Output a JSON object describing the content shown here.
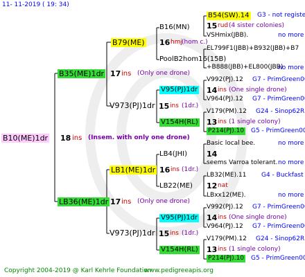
{
  "header": {
    "date": "11-  11-2019 (  19:  34)"
  },
  "footer": {
    "copyright": "Copyright 2004-2019 @ Karl Kehrle Foundation",
    "website": "www.pedigreeapis.org"
  },
  "root": {
    "name": "B10(ME)1dr"
  },
  "root_info": {
    "count": "18",
    "unit": "ins",
    "note": "(Insem. with only one drone)"
  },
  "upper": {
    "name": "B35(ME)1dr",
    "count": "17",
    "unit": "ins",
    "note": "(Only one drone)",
    "dam": {
      "name": "B79(ME)",
      "count": "16",
      "unit": "hmj",
      "note": "(hom c.)",
      "dam": {
        "name": "B16(MN)",
        "count": "15",
        "unit": "rud",
        "note": "(4 sister colonies)",
        "dam": "B54(SW).14",
        "dam_meta": "G3 - not registe",
        "sire": "VSHmix(JBB).",
        "sire_meta": "no more"
      },
      "sire": {
        "name": "PoolB2hom16(15B)",
        "dam": "EL799F1(JBB)+B932(JBB)+B7",
        "sire": "+B888(JBB)+EL800(JBB)",
        "sire_meta": "no more"
      }
    },
    "sire": {
      "name": "V973(PJ)1dr",
      "count": "15",
      "unit": "ins",
      "note": "(1dr.)",
      "dam": {
        "name": "V95(PJ)1dr",
        "count": "14",
        "unit": "ins",
        "note": "(One single drone)",
        "dam": "V992(PJ).12",
        "dam_meta": "G7 - PrimGreen00",
        "sire": "V964(PJ).12",
        "sire_meta": "G7 - PrimGreen00"
      },
      "sire": {
        "name": "V154H(RL)",
        "count": "13",
        "unit": "ins",
        "note": "(1 single colony)",
        "dam": "V179(PM).12",
        "dam_meta": "G24 - Sinop62R",
        "sire": "P214(PJ).10",
        "sire_meta": "G5 - PrimGreen00"
      }
    }
  },
  "lower": {
    "name": "LB36(ME)1dr",
    "count": "17",
    "unit": "ins",
    "note": "(Only one drone)",
    "dam": {
      "name": "LB1(ME)1dr",
      "count": "16",
      "unit": "ins",
      "note": "(1dr.)",
      "dam": {
        "name": "LB4(JHI)",
        "count": "14",
        "dam": "Basic local bee.",
        "dam_meta": "no more",
        "sire": "seems Varroa tolerant.",
        "sire_meta": "no more"
      },
      "sire": {
        "name": "LB22(ME)",
        "count": "12",
        "unit": "nat",
        "dam": "LB32(ME).11",
        "dam_meta": "G4 - Buckfast",
        "sire": "LBxx12(ME).",
        "sire_meta": "no more"
      }
    },
    "sire": {
      "name": "V973(PJ)1dr",
      "count": "15",
      "unit": "ins",
      "note": "(1dr.)",
      "dam": {
        "name": "V95(PJ)1dr",
        "count": "14",
        "unit": "ins",
        "note": "(One single drone)",
        "dam": "V992(PJ).12",
        "dam_meta": "G7 - PrimGreen00",
        "sire": "V964(PJ).12",
        "sire_meta": "G7 - PrimGreen00"
      },
      "sire": {
        "name": "V154H(RL)",
        "count": "13",
        "unit": "ins",
        "note": "(1 single colony)",
        "dam": "V179(PM).12",
        "dam_meta": "G24 - Sinop62R",
        "sire": "P214(PJ).10",
        "sire_meta": "G5 - PrimGreen00"
      }
    }
  },
  "colors": {
    "yellow": "#ffff00",
    "green": "#33dd33",
    "cyan": "#00ffff",
    "pink": "#ffccff",
    "line": "#000000",
    "ins": "#cc0000",
    "note": "#7700aa",
    "meta": "#0000ff"
  }
}
